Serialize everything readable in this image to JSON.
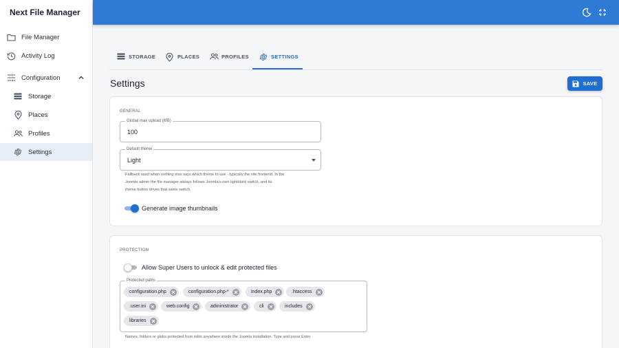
{
  "app": {
    "title": "Next File Manager"
  },
  "sidebar": {
    "items": [
      {
        "label": "File Manager",
        "icon": "folder-icon"
      },
      {
        "label": "Activity Log",
        "icon": "history-icon"
      },
      {
        "label": "Configuration",
        "icon": "tune-icon",
        "expanded": true
      },
      {
        "label": "Storage",
        "icon": "storage-icon"
      },
      {
        "label": "Places",
        "icon": "place-icon"
      },
      {
        "label": "Profiles",
        "icon": "people-icon"
      },
      {
        "label": "Settings",
        "icon": "gear-icon",
        "active": true
      }
    ]
  },
  "topbar": {
    "color": "#2f7ad4",
    "icons": [
      "theme-moon-icon",
      "exit-fullscreen-icon"
    ]
  },
  "tabs": [
    {
      "label": "STORAGE",
      "icon": "storage-icon"
    },
    {
      "label": "PLACES",
      "icon": "place-icon"
    },
    {
      "label": "PROFILES",
      "icon": "people-icon"
    },
    {
      "label": "SETTINGS",
      "icon": "gear-icon",
      "active": true
    }
  ],
  "page": {
    "title": "Settings",
    "save_label": "SAVE"
  },
  "general": {
    "section_label": "GENERAL",
    "max_upload": {
      "label": "Global max upload (MB)",
      "value": "100"
    },
    "default_theme": {
      "label": "Default theme",
      "value": "Light"
    },
    "theme_help": [
      "Fallback used when nothing else says which theme to use - typically the site frontend. In the",
      "Joomla admin the file manager always follows Joomla's own light/dark switch, and its",
      "theme button drives that same switch."
    ],
    "thumbnails": {
      "label": "Generate image thumbnails",
      "enabled": true
    }
  },
  "protection": {
    "section_label": "PROTECTION",
    "super_users": {
      "label": "Allow Super Users to unlock & edit protected files",
      "enabled": false
    },
    "paths_label": "Protected paths",
    "paths": [
      "configuration.php",
      "configuration.php-*",
      "index.php",
      ".htaccess",
      ".user.ini",
      "web.config",
      "administrator",
      "cli",
      "includes",
      "libraries"
    ],
    "paths_help": "Names, folders or globs protected from edits anywhere inside the Joomla installation. Type and press Enter."
  },
  "colors": {
    "accent": "#1f6fd1",
    "topbar": "#2f7ad4"
  }
}
